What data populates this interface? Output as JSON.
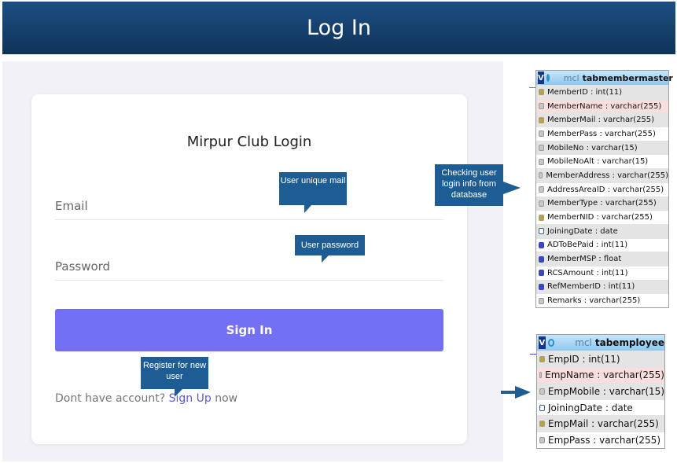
{
  "header": {
    "title": "Log In"
  },
  "login": {
    "title": "Mirpur Club Login",
    "email_placeholder": "Email",
    "password_placeholder": "Password",
    "signin_label": "Sign In",
    "account_prompt": "Dont have account?",
    "signup_link": "Sign Up",
    "signup_suffix": "now"
  },
  "callouts": {
    "mail": "User unique mail",
    "password": "User password",
    "register": "Register for new user",
    "database": "Checking user login info from database"
  },
  "tables": [
    {
      "db": "mcl",
      "name": "tabmembermaster",
      "columns": [
        {
          "text": "MemberID : int(11)",
          "icon": "key"
        },
        {
          "text": "MemberName : varchar(255)",
          "icon": "idx"
        },
        {
          "text": "MemberMail : varchar(255)",
          "icon": "key"
        },
        {
          "text": "MemberPass : varchar(255)",
          "icon": "idx"
        },
        {
          "text": "MobileNo : varchar(15)",
          "icon": "idx"
        },
        {
          "text": "MobileNoAlt : varchar(15)",
          "icon": "idx"
        },
        {
          "text": "MemberAddress : varchar(255)",
          "icon": "idx"
        },
        {
          "text": "AddressAreaID : varchar(255)",
          "icon": "idx"
        },
        {
          "text": "MemberType : varchar(255)",
          "icon": "idx"
        },
        {
          "text": "MemberNID : varchar(255)",
          "icon": "key"
        },
        {
          "text": "JoiningDate : date",
          "icon": "cal"
        },
        {
          "text": "ADToBePaid : int(11)",
          "icon": "num"
        },
        {
          "text": "MemberMSP : float",
          "icon": "num"
        },
        {
          "text": "RCSAmount : int(11)",
          "icon": "num"
        },
        {
          "text": "RefMemberID : int(11)",
          "icon": "num"
        },
        {
          "text": "Remarks : varchar(255)",
          "icon": "idx"
        }
      ]
    },
    {
      "db": "mcl",
      "name": "tabemployee",
      "columns": [
        {
          "text": "EmpID : int(11)",
          "icon": "key"
        },
        {
          "text": "EmpName : varchar(255)",
          "icon": "idx"
        },
        {
          "text": "EmpMobile : varchar(15)",
          "icon": "idx"
        },
        {
          "text": "JoiningDate : date",
          "icon": "cal"
        },
        {
          "text": "EmpMail : varchar(255)",
          "icon": "key"
        },
        {
          "text": "EmpPass : varchar(255)",
          "icon": "idx"
        }
      ]
    }
  ],
  "colors": {
    "banner": "#1c4f84",
    "button": "#7470f5",
    "callout": "#1d5d94"
  }
}
